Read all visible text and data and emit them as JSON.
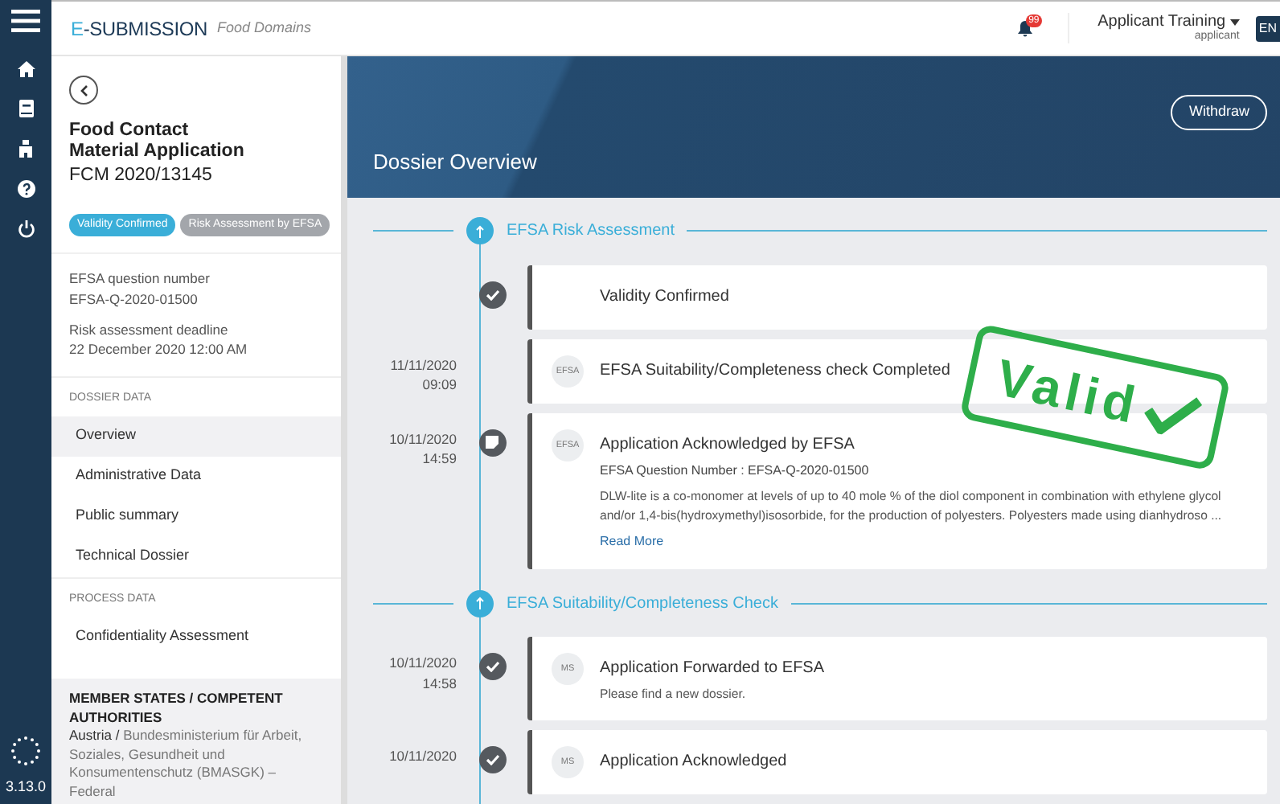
{
  "app": {
    "brand_prefix": "E",
    "brand_rest": "-SUBMISSION",
    "subtitle": "Food Domains",
    "version": "3.13.0"
  },
  "header": {
    "notification_count": "99",
    "user_name": "Applicant Training",
    "user_role": "applicant",
    "language": "EN"
  },
  "sidebar": {
    "title_lines": [
      "Food Contact",
      "Material Application"
    ],
    "code": "FCM 2020/13145",
    "badges": [
      {
        "label": "Validity Confirmed",
        "color": "#3aaed8"
      },
      {
        "label": "Risk Assessment by EFSA",
        "color": "#a3a6ab"
      }
    ],
    "info": [
      {
        "label": "EFSA question number",
        "value": "EFSA-Q-2020-01500"
      },
      {
        "label": "Risk assessment deadline",
        "value": "22 December 2020 12:00 AM"
      }
    ],
    "groups": [
      {
        "heading": "DOSSIER DATA",
        "items": [
          {
            "label": "Overview",
            "selected": true
          },
          {
            "label": "Administrative Data",
            "selected": false
          },
          {
            "label": "Public summary",
            "selected": false
          },
          {
            "label": "Technical Dossier",
            "selected": false
          }
        ]
      },
      {
        "heading": "PROCESS DATA",
        "items": [
          {
            "label": "Confidentiality Assessment",
            "selected": false
          }
        ]
      }
    ],
    "member_states": {
      "heading": "MEMBER STATES / COMPETENT AUTHORITIES",
      "country": "Austria /",
      "authority": "Bundesministerium für Arbeit, Soziales, Gesundheit und Konsumentenschutz (BMASGK) – Federal"
    }
  },
  "banner": {
    "title": "Dossier Overview",
    "button": "Withdraw"
  },
  "stamp": "Valid",
  "timeline": [
    {
      "kind": "section",
      "title": "EFSA Risk Assessment"
    },
    {
      "kind": "checked",
      "title": "Validity Confirmed"
    },
    {
      "kind": "plain",
      "date": "11/11/2020",
      "time": "09:09",
      "avatar": "EFSA",
      "title": "EFSA Suitability/Completeness check Completed"
    },
    {
      "kind": "noted",
      "date": "10/11/2020",
      "time": "14:59",
      "avatar": "EFSA",
      "title": "Application Acknowledged by EFSA",
      "subtitle": "EFSA Question Number : EFSA-Q-2020-01500",
      "body": "DLW-lite is a co-monomer at levels of up to 40 mole % of the diol component in combination with ethylene glycol and/or 1,4-bis(hydroxymethyl)isosorbide, for the production of polyesters. Polyesters made using dianhydroso ...",
      "link": "Read More"
    },
    {
      "kind": "section",
      "title": "EFSA Suitability/Completeness Check"
    },
    {
      "kind": "checked",
      "date": "10/11/2020",
      "time": "14:58",
      "avatar": "MS",
      "title": "Application Forwarded to EFSA",
      "body": "Please find a new dossier."
    },
    {
      "kind": "checked",
      "date": "10/11/2020",
      "avatar": "MS",
      "title": "Application Acknowledged"
    }
  ]
}
